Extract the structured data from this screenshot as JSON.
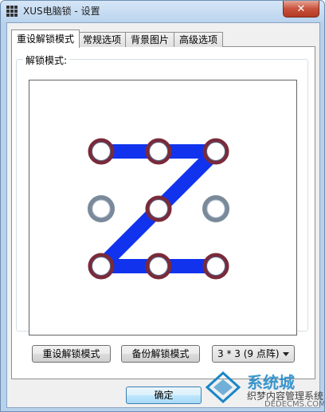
{
  "window": {
    "title": "XUS电脑锁 - 设置",
    "close_label": "✕"
  },
  "tabs": [
    {
      "label": "重设解锁模式",
      "active": true
    },
    {
      "label": "常规选项",
      "active": false
    },
    {
      "label": "背景图片",
      "active": false
    },
    {
      "label": "高级选项",
      "active": false
    }
  ],
  "group": {
    "label": "解锁模式:"
  },
  "pattern": {
    "grid": "3x3",
    "selected_nodes": [
      0,
      1,
      2,
      4,
      6,
      7,
      8
    ],
    "path": [
      0,
      1,
      2,
      4,
      6,
      7,
      8
    ],
    "line_color": "#1133ee",
    "selected_ring_color": "#7a2a3a",
    "idle_ring_color": "#7a8a9a"
  },
  "buttons": {
    "reset_label": "重设解锁模式",
    "backup_label": "备份解锁模式",
    "ok_label": "确定"
  },
  "grid_select": {
    "value": "3 * 3 (9 点阵)"
  },
  "watermark": {
    "line1": "系统城",
    "line2": "织梦内容管理系统",
    "line3": "DEDECMS.COM"
  }
}
